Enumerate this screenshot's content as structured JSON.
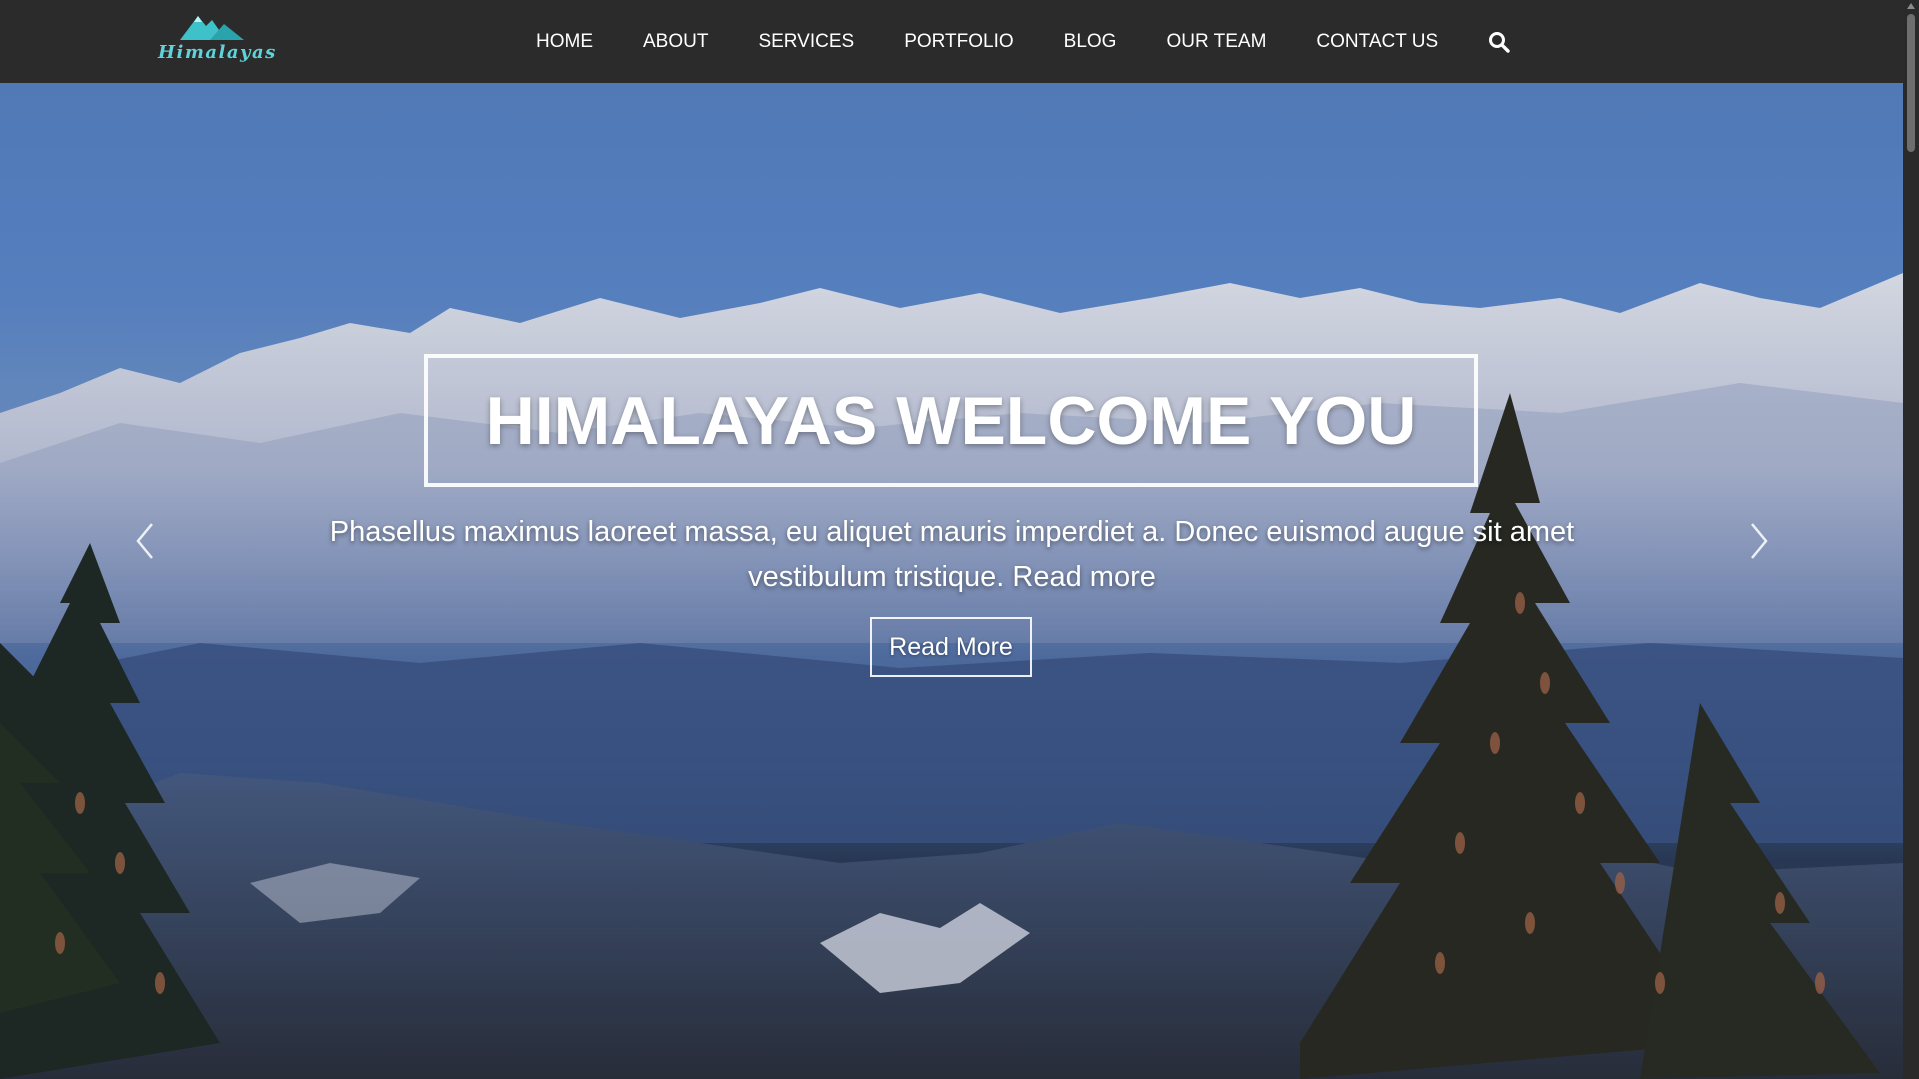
{
  "header": {
    "logo_text": "Himalayas",
    "nav": [
      {
        "label": "HOME"
      },
      {
        "label": "ABOUT"
      },
      {
        "label": "SERVICES"
      },
      {
        "label": "PORTFOLIO"
      },
      {
        "label": "BLOG"
      },
      {
        "label": "OUR TEAM"
      },
      {
        "label": "CONTACT US"
      }
    ],
    "search_icon": "search-icon"
  },
  "hero": {
    "title": "HIMALAYAS WELCOME YOU",
    "subtitle": "Phasellus maximus laoreet massa, eu aliquet mauris imperdiet a. Donec euismod augue sit amet vestibulum tristique. Read more",
    "button_label": "Read More",
    "prev_icon": "chevron-left-icon",
    "next_icon": "chevron-right-icon"
  },
  "colors": {
    "header_bg": "#2b2b2b",
    "logo_accent": "#3fc1c9",
    "text": "#ffffff"
  }
}
